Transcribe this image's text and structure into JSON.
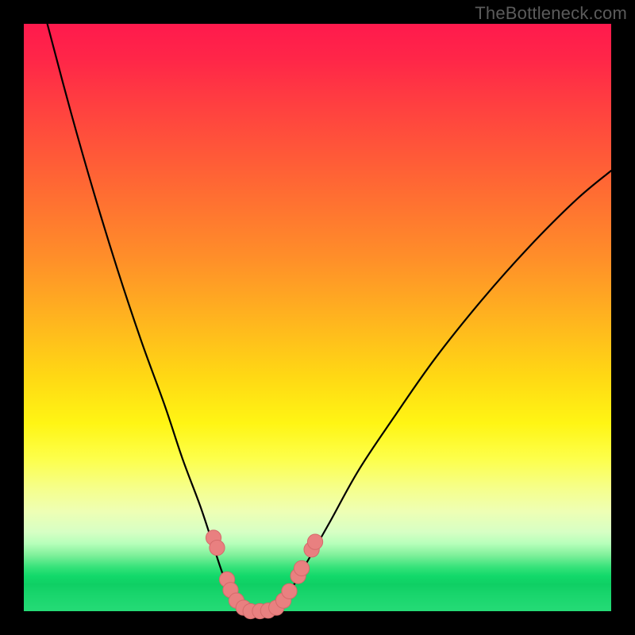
{
  "watermark": "TheBottleneck.com",
  "chart_data": {
    "type": "line",
    "title": "",
    "xlabel": "",
    "ylabel": "",
    "xlim": [
      0,
      100
    ],
    "ylim": [
      0,
      100
    ],
    "legend": false,
    "annotations": [],
    "left_curve": {
      "description": "steep descending curve from top-left to valley",
      "points": [
        {
          "x": 4,
          "y": 100
        },
        {
          "x": 8,
          "y": 85
        },
        {
          "x": 12,
          "y": 71
        },
        {
          "x": 16,
          "y": 58
        },
        {
          "x": 20,
          "y": 46
        },
        {
          "x": 24,
          "y": 35
        },
        {
          "x": 27,
          "y": 26
        },
        {
          "x": 30,
          "y": 18
        },
        {
          "x": 32,
          "y": 12
        },
        {
          "x": 34,
          "y": 6
        },
        {
          "x": 36,
          "y": 2
        },
        {
          "x": 38,
          "y": 0
        }
      ]
    },
    "right_curve": {
      "description": "ascending curve from valley toward upper right",
      "points": [
        {
          "x": 42,
          "y": 0
        },
        {
          "x": 45,
          "y": 3
        },
        {
          "x": 48,
          "y": 8
        },
        {
          "x": 52,
          "y": 15
        },
        {
          "x": 57,
          "y": 24
        },
        {
          "x": 63,
          "y": 33
        },
        {
          "x": 70,
          "y": 43
        },
        {
          "x": 78,
          "y": 53
        },
        {
          "x": 86,
          "y": 62
        },
        {
          "x": 94,
          "y": 70
        },
        {
          "x": 100,
          "y": 75
        }
      ]
    },
    "valley_floor": {
      "description": "flat bottom segment connecting curves",
      "points": [
        {
          "x": 38,
          "y": 0
        },
        {
          "x": 42,
          "y": 0
        }
      ]
    },
    "beads_left": [
      {
        "x": 32.3,
        "y": 12.5
      },
      {
        "x": 32.9,
        "y": 10.8
      },
      {
        "x": 34.6,
        "y": 5.4
      },
      {
        "x": 35.2,
        "y": 3.6
      },
      {
        "x": 36.2,
        "y": 1.8
      },
      {
        "x": 37.4,
        "y": 0.6
      }
    ],
    "beads_bottom": [
      {
        "x": 38.6,
        "y": 0
      },
      {
        "x": 40.2,
        "y": 0
      },
      {
        "x": 41.6,
        "y": 0.1
      },
      {
        "x": 43.0,
        "y": 0.6
      }
    ],
    "beads_right": [
      {
        "x": 44.2,
        "y": 1.8
      },
      {
        "x": 45.2,
        "y": 3.4
      },
      {
        "x": 46.7,
        "y": 6.0
      },
      {
        "x": 47.3,
        "y": 7.3
      },
      {
        "x": 49.0,
        "y": 10.5
      },
      {
        "x": 49.6,
        "y": 11.8
      }
    ],
    "bead_radius": 1.3
  }
}
